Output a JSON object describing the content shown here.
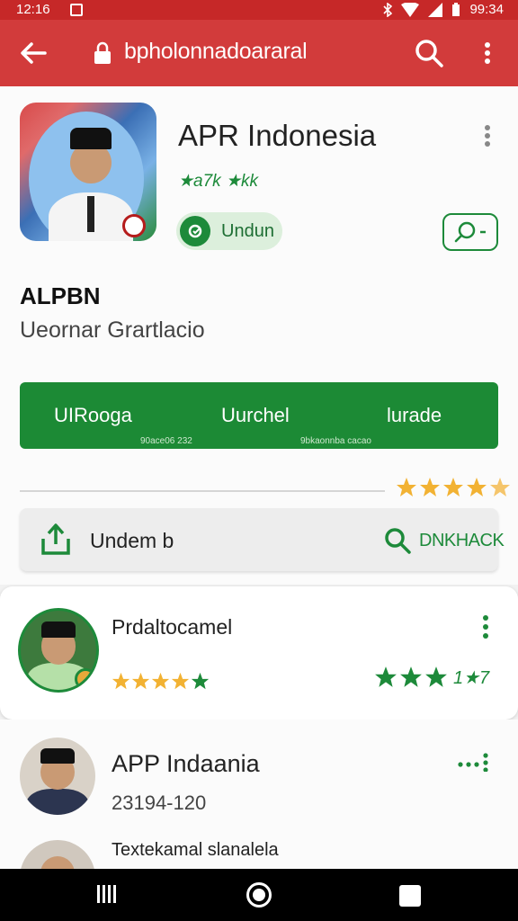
{
  "status_bar": {
    "time": "12:16",
    "clock_right": "99:34"
  },
  "toolbar": {
    "url": "bpholonnadoararal"
  },
  "app": {
    "name": "APR Indonesia",
    "rating_text": "★a7k ★kk",
    "install_label": "Undun",
    "developer": "ALPBN",
    "subtitle": "Ueornar Grartlacio"
  },
  "tabs": [
    {
      "label": "UIRooga",
      "sub": ""
    },
    {
      "label": "Uurchel",
      "sub": ""
    },
    {
      "label": "lurade",
      "sub": ""
    }
  ],
  "tab_captions": [
    "90ace06 232",
    "9bkaonnba cacao"
  ],
  "action_bar": {
    "label": "Undem b",
    "find_label": "DNKHACK"
  },
  "list": [
    {
      "title": "Prdaltocamel",
      "extra": "1★7"
    },
    {
      "title": "APP Indaania",
      "subtitle": "23194-120"
    },
    {
      "title": "Textekamal slanalela"
    }
  ],
  "colors": {
    "toolbar": "#d23b3b",
    "status_bar": "#c62828",
    "accent_green": "#1d8a3a",
    "star_gold": "#f2b233"
  }
}
